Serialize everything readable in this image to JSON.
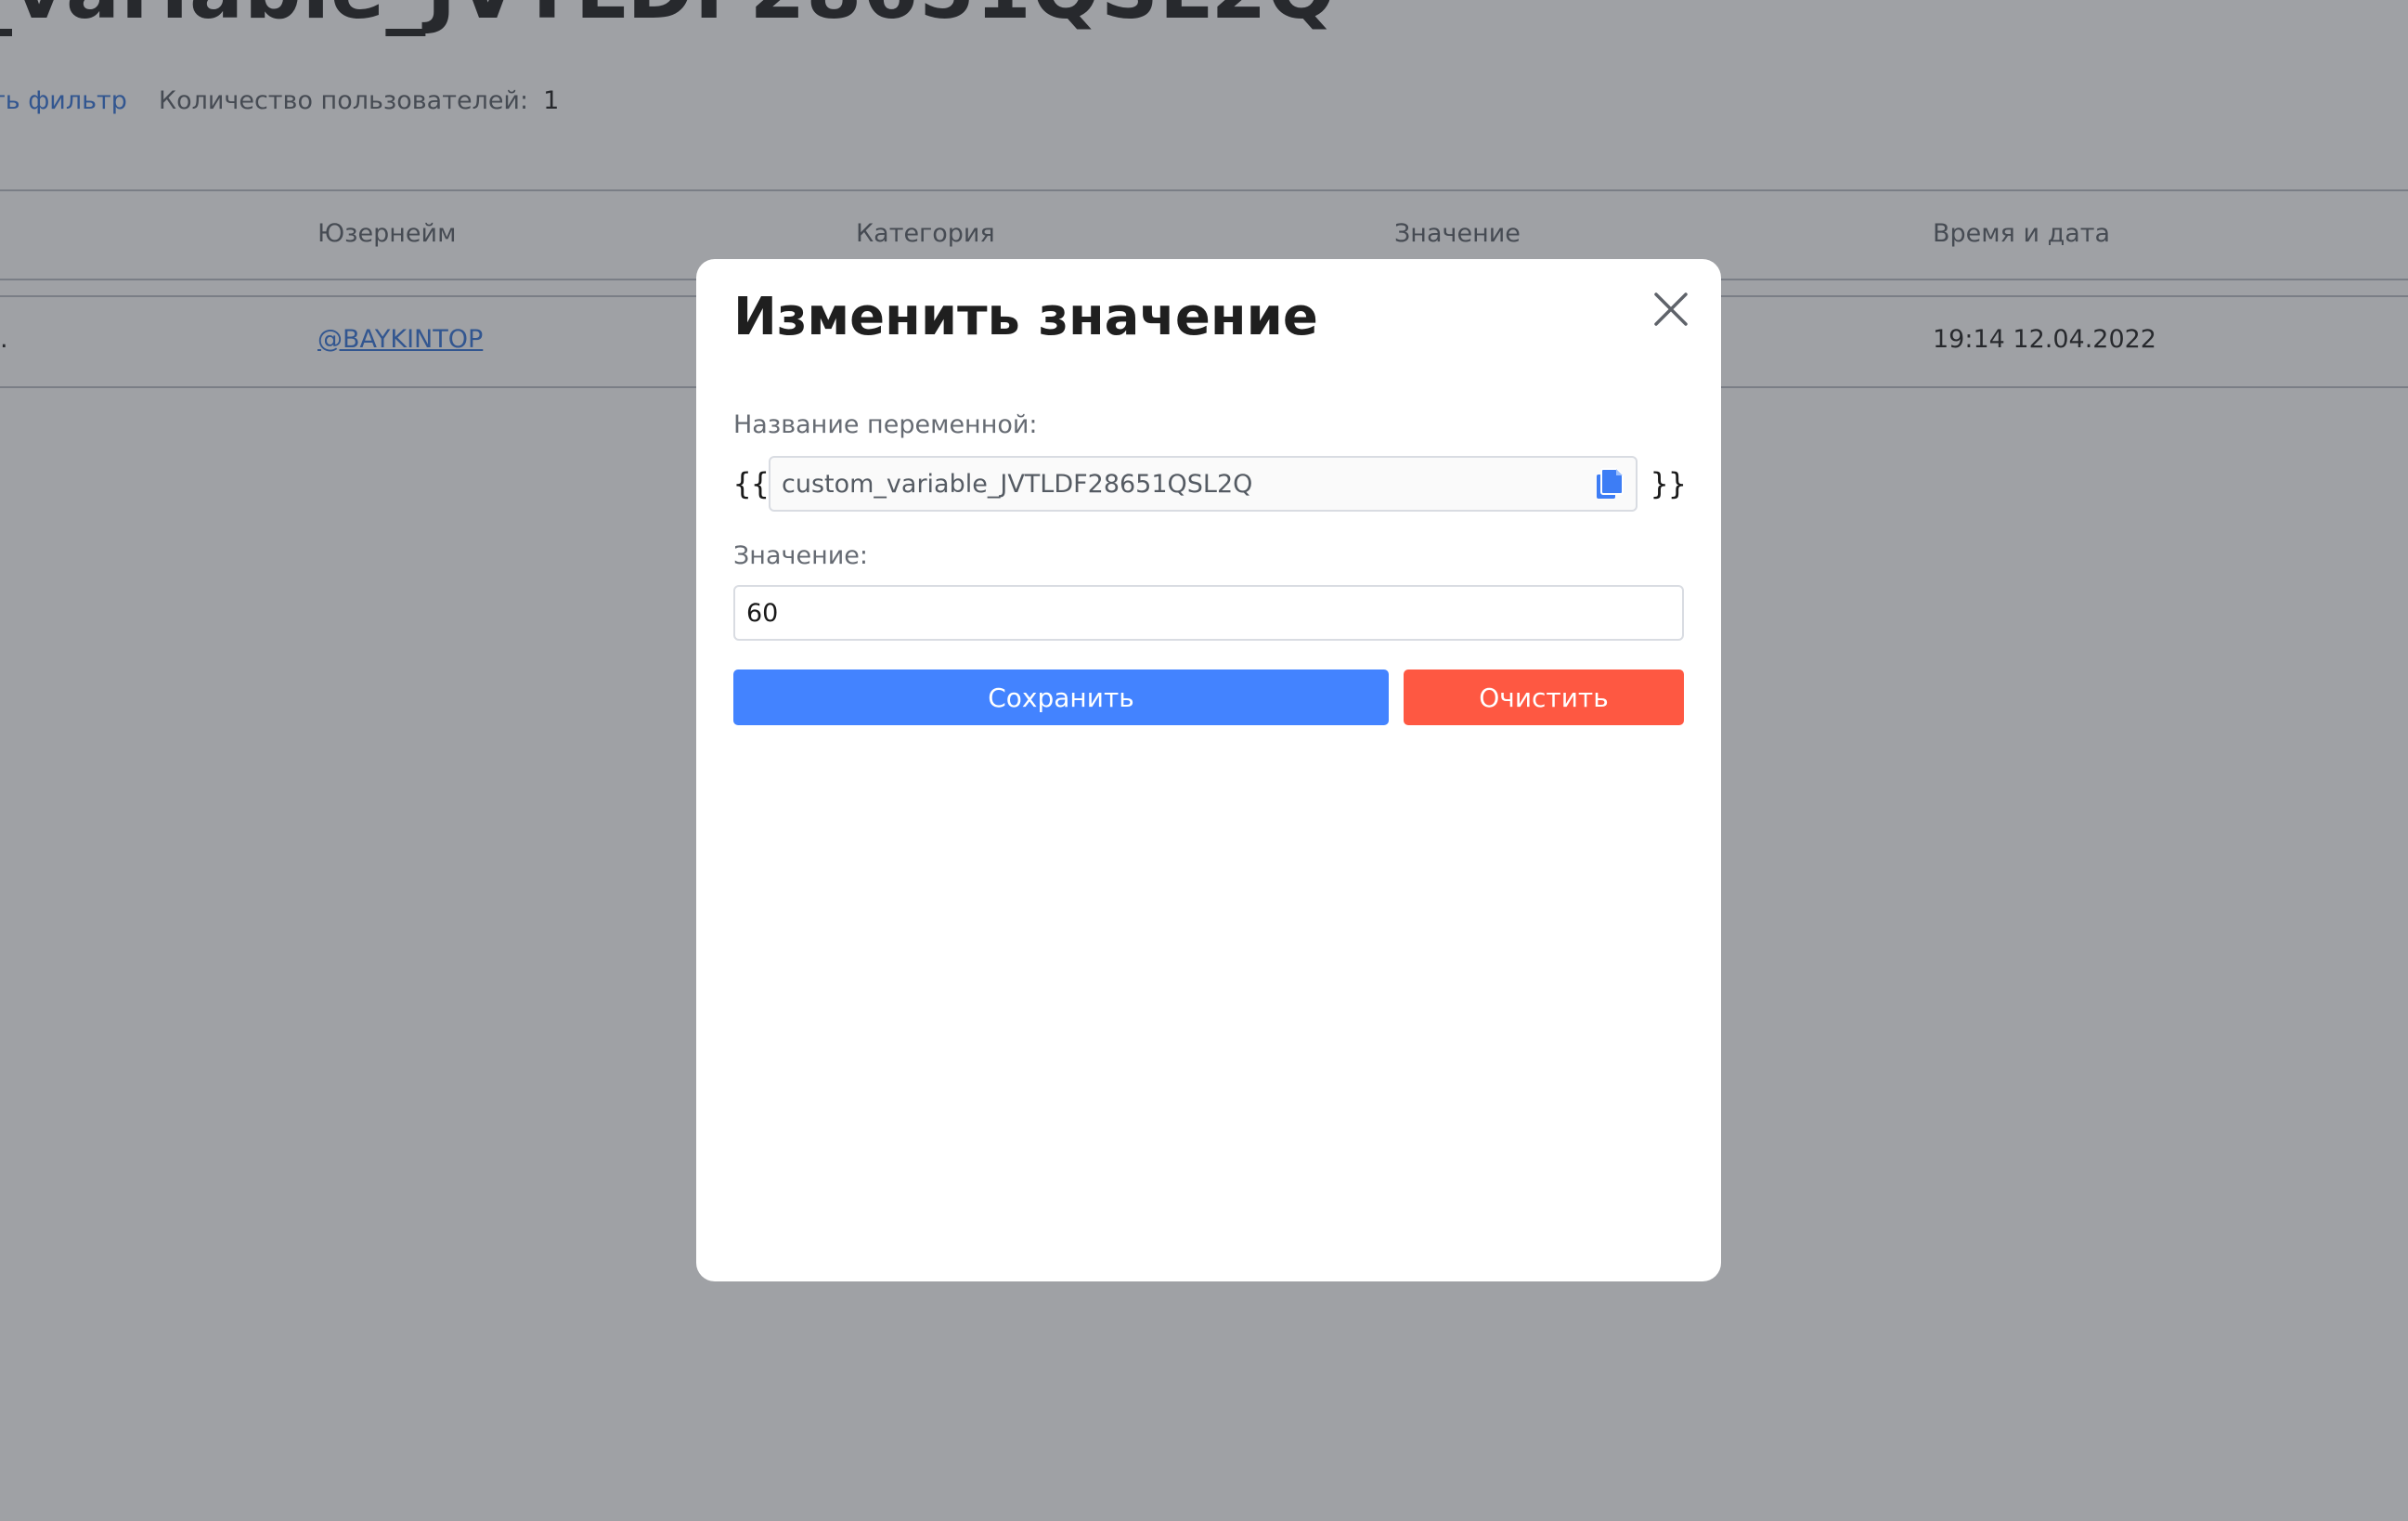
{
  "background": {
    "page_title": "_variable_JVTLDF28651QSL2Q",
    "filter_link": "ть фильтр",
    "user_count_label": "Количество пользователей:",
    "user_count_value": "1",
    "table": {
      "headers": [
        "Юзернейм",
        "Категория",
        "Значение",
        "Время и дата"
      ],
      "row": {
        "first_cell_fragment": ".",
        "username": "@BAYKINTOP",
        "datetime": "19:14 12.04.2022"
      }
    }
  },
  "modal": {
    "title": "Изменить значение",
    "variable_name_label": "Название переменной:",
    "open_brace": "{{",
    "close_brace": "}}",
    "variable_name_value": "custom_variable_JVTLDF28651QSL2Q",
    "value_label": "Значение:",
    "value": "60",
    "save_label": "Сохранить",
    "clear_label": "Очистить",
    "icons": {
      "close": "close-icon",
      "copy": "copy-icon"
    }
  },
  "colors": {
    "overlay": "#373a42",
    "link": "#2f6fd6",
    "save_button": "#4383ff",
    "clear_button": "#fe5842",
    "copy_icon": "#3d7df5"
  }
}
